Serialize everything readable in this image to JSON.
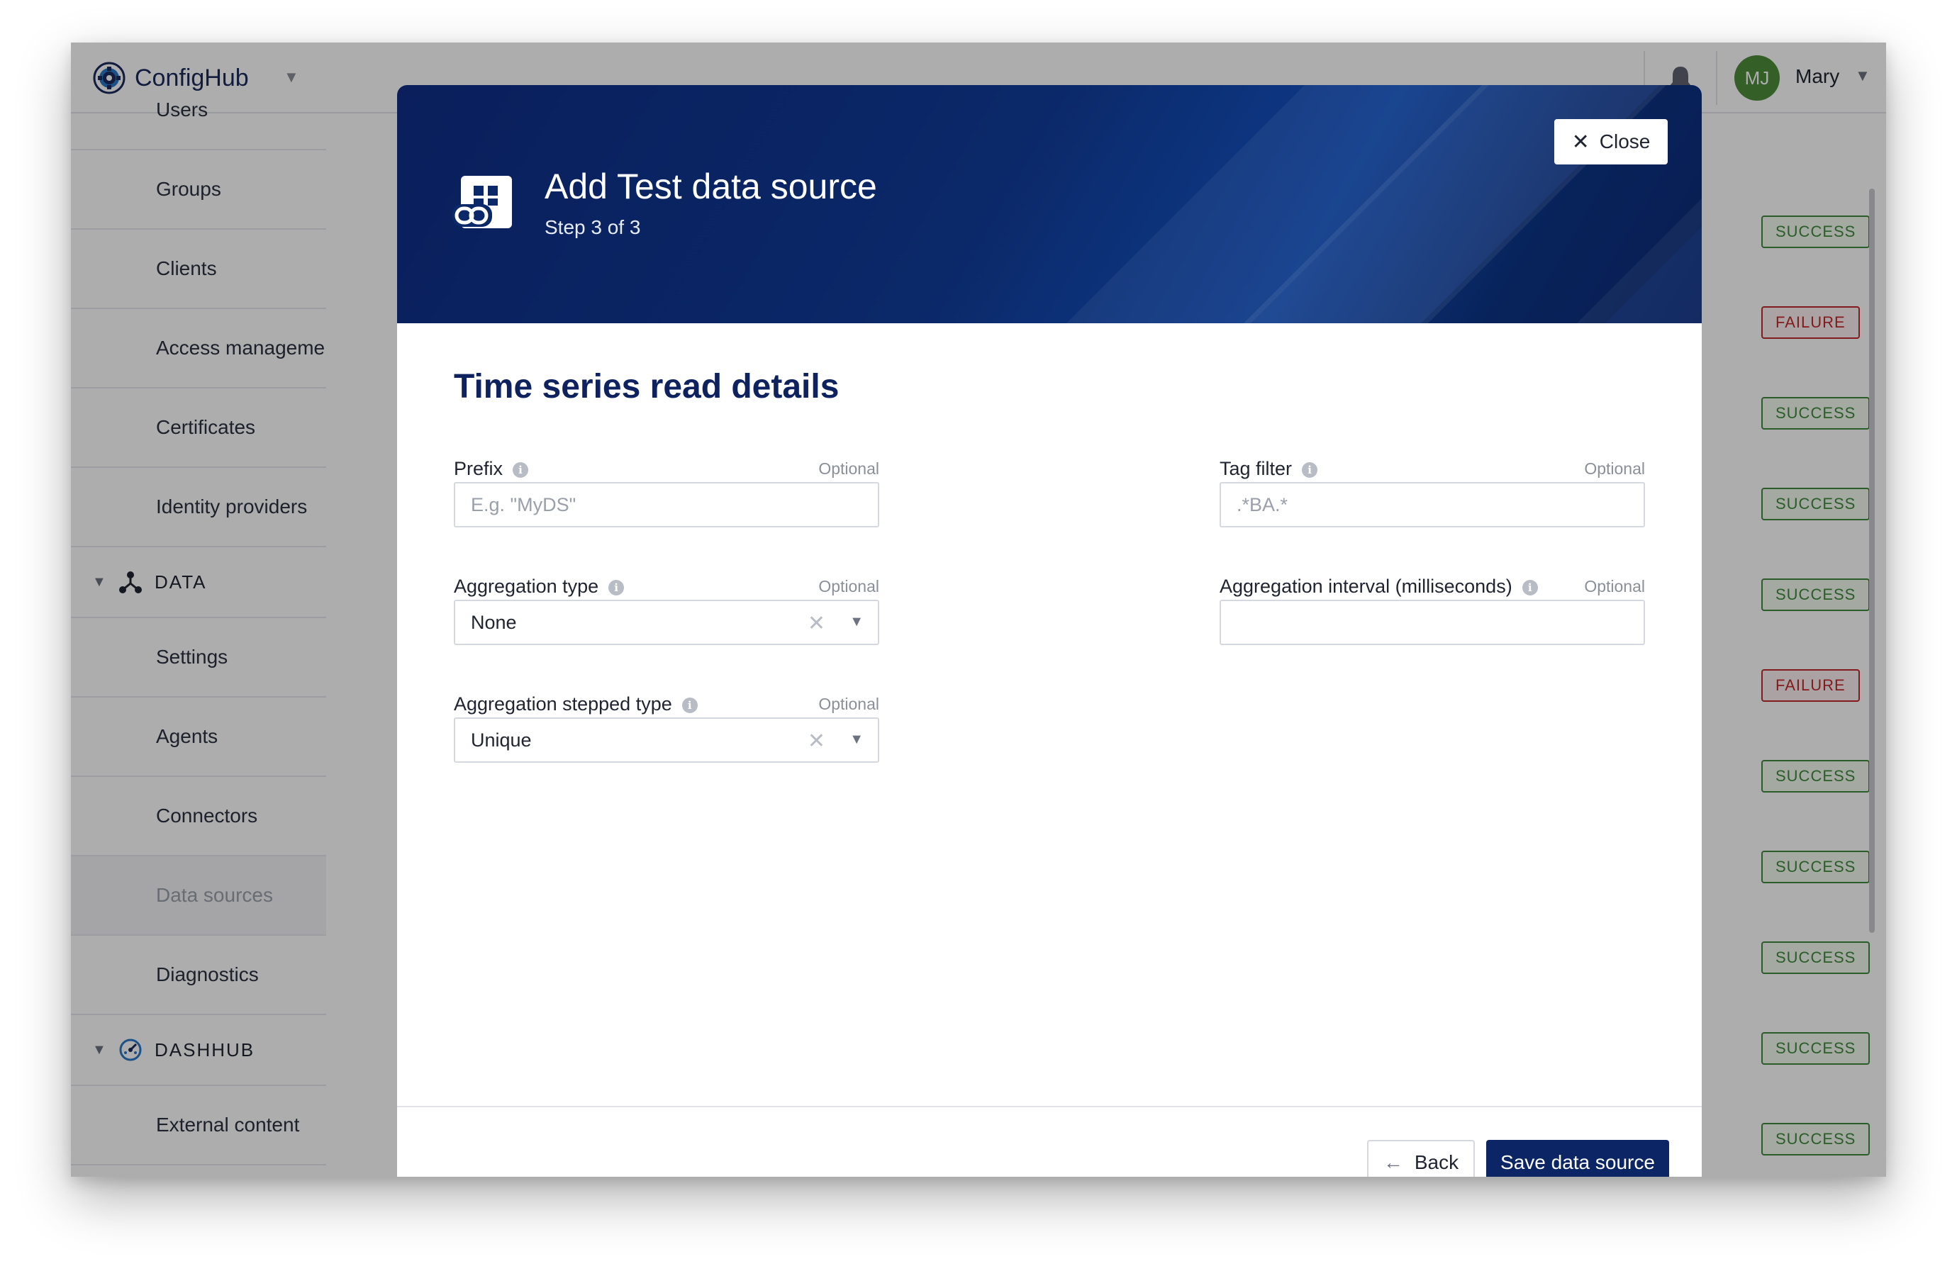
{
  "header": {
    "brand": "ConfigHub",
    "user_initials": "MJ",
    "user_name": "Mary",
    "avatar_color": "#4d8c3a",
    "brand_icon": "gear-icon",
    "notification_icon": "bell-icon"
  },
  "sidebar": {
    "items": [
      {
        "label": "Users"
      },
      {
        "label": "Groups"
      },
      {
        "label": "Clients"
      },
      {
        "label": "Access management"
      },
      {
        "label": "Certificates"
      },
      {
        "label": "Identity providers"
      }
    ],
    "data_section": {
      "label": "DATA",
      "icon": "network-icon"
    },
    "data_items": [
      {
        "label": "Settings"
      },
      {
        "label": "Agents"
      },
      {
        "label": "Connectors"
      },
      {
        "label": "Data sources",
        "active": true
      },
      {
        "label": "Diagnostics"
      }
    ],
    "dashhub_section": {
      "label": "DASHHUB",
      "icon": "dashboard-icon"
    },
    "dashhub_items": [
      {
        "label": "External content"
      }
    ]
  },
  "statuses": [
    {
      "label": "SUCCESS"
    },
    {
      "label": "FAILURE"
    },
    {
      "label": "SUCCESS"
    },
    {
      "label": "SUCCESS"
    },
    {
      "label": "SUCCESS"
    },
    {
      "label": "FAILURE"
    },
    {
      "label": "SUCCESS"
    },
    {
      "label": "SUCCESS"
    },
    {
      "label": "SUCCESS"
    },
    {
      "label": "SUCCESS"
    },
    {
      "label": "SUCCESS"
    }
  ],
  "colors": {
    "success": "#3f8a3a",
    "failure": "#c0282d",
    "primary": "#0c2564",
    "header_bg": "#0b2868"
  },
  "modal": {
    "title": "Add Test data source",
    "step": "Step 3 of 3",
    "icon": "data-source-link-icon",
    "close_label": "Close",
    "section_title": "Time series read details",
    "fields": {
      "prefix": {
        "label": "Prefix",
        "optional": "Optional",
        "placeholder": "E.g. \"MyDS\"",
        "value": ""
      },
      "tag_filter": {
        "label": "Tag filter",
        "optional": "Optional",
        "placeholder": ".*BA.*",
        "value": ""
      },
      "aggregation_type": {
        "label": "Aggregation type",
        "optional": "Optional",
        "value": "None"
      },
      "aggregation_interval": {
        "label": "Aggregation interval (milliseconds)",
        "optional": "Optional",
        "value": ""
      },
      "aggregation_stepped_type": {
        "label": "Aggregation stepped type",
        "optional": "Optional",
        "value": "Unique"
      }
    },
    "back_label": "Back",
    "save_label": "Save data source"
  }
}
